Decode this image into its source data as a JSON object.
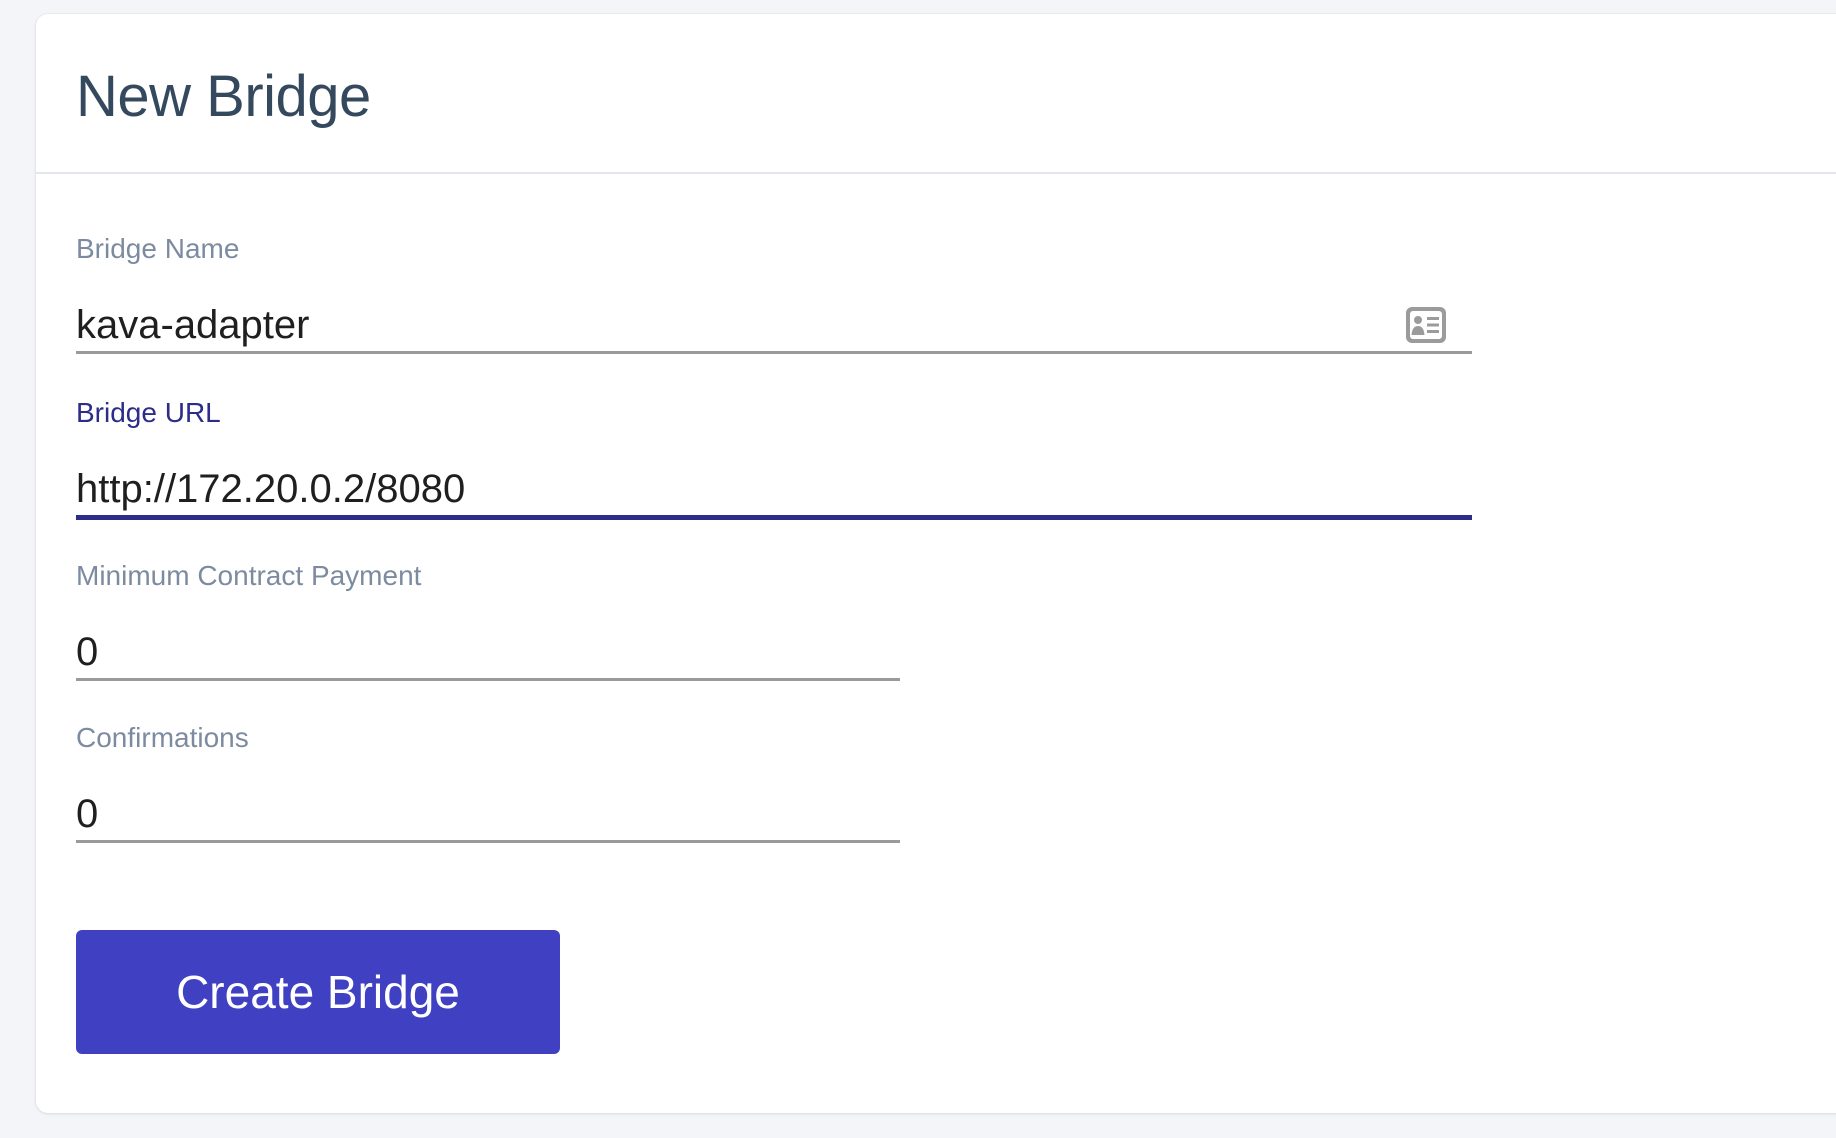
{
  "page": {
    "title": "New Bridge"
  },
  "form": {
    "bridge_name": {
      "label": "Bridge Name",
      "value": "kava-adapter",
      "icon": "contact-card-icon"
    },
    "bridge_url": {
      "label": "Bridge URL",
      "value": "http://172.20.0.2/8080",
      "focused": true
    },
    "min_contract_payment": {
      "label": "Minimum Contract Payment",
      "value": "0"
    },
    "confirmations": {
      "label": "Confirmations",
      "value": "0"
    },
    "submit_label": "Create Bridge"
  },
  "colors": {
    "accent": "#3f41c2",
    "focus_underline": "#2b2d88",
    "title": "#34495e",
    "label": "#7d8ba1",
    "background": "#f4f5f8"
  }
}
